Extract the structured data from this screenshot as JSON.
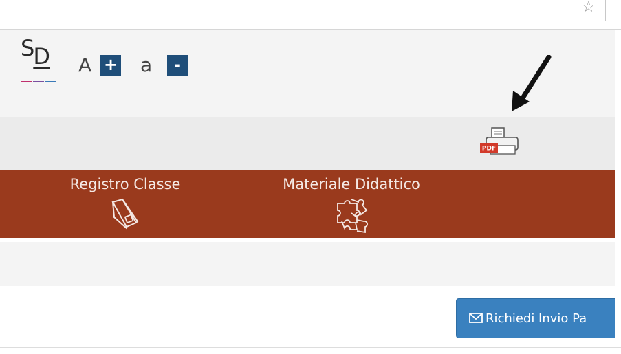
{
  "browser": {
    "bookmark_icon": "bookmark-star-icon"
  },
  "logo": {
    "letter_s": "S",
    "letter_d": "D",
    "colors": [
      "#c0306e",
      "#7a4fa0",
      "#3a7ab8"
    ]
  },
  "font_controls": {
    "increase_letter": "A",
    "increase_symbol": "+",
    "decrease_letter": "a",
    "decrease_symbol": "-"
  },
  "toolbar": {
    "pdf_icon": "pdf-print-icon",
    "pdf_badge": "PDF"
  },
  "nav": {
    "background": "#9a3a1d",
    "items": [
      {
        "label": "Registro Classe",
        "icon": "book-icon"
      },
      {
        "label": "Materiale Didattico",
        "icon": "puzzle-icon"
      }
    ]
  },
  "actions": {
    "request_button_label": "Richiedi Invio Pa",
    "request_button_icon": "envelope-icon",
    "accent": "#3a81bf"
  }
}
